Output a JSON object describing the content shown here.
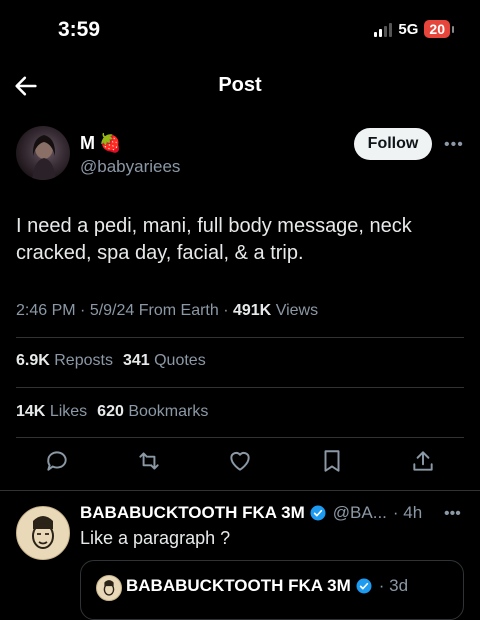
{
  "status_bar": {
    "time": "3:59",
    "network": "5G",
    "battery": "20"
  },
  "header": {
    "title": "Post"
  },
  "author": {
    "name": "M",
    "emoji": "🍓",
    "handle": "@babyariees",
    "follow_label": "Follow"
  },
  "tweet": {
    "text": "I need a pedi, mani, full body message, neck cracked, spa day, facial, & a trip."
  },
  "meta": {
    "time": "2:46 PM",
    "date": "5/9/24",
    "source": "From Earth",
    "views_count": "491K",
    "views_label": "Views"
  },
  "stats": {
    "reposts_count": "6.9K",
    "reposts_label": "Reposts",
    "quotes_count": "341",
    "quotes_label": "Quotes",
    "likes_count": "14K",
    "likes_label": "Likes",
    "bookmarks_count": "620",
    "bookmarks_label": "Bookmarks"
  },
  "actions": [
    "reply-icon",
    "repost-icon",
    "like-icon",
    "bookmark-icon",
    "share-icon"
  ],
  "reply": {
    "name": "BABABUCKTOOTH FKA 3M",
    "handle": "@BA...",
    "age": "· 4h",
    "text": "Like a paragraph ?",
    "quote_name": "BABABUCKTOOTH FKA 3M",
    "quote_age": "· 3d"
  },
  "colors": {
    "background": "#000000",
    "text": "#e7e9ea",
    "muted": "#8b98a5",
    "verified": "#1d9bf0",
    "battery": "#e6453b"
  }
}
